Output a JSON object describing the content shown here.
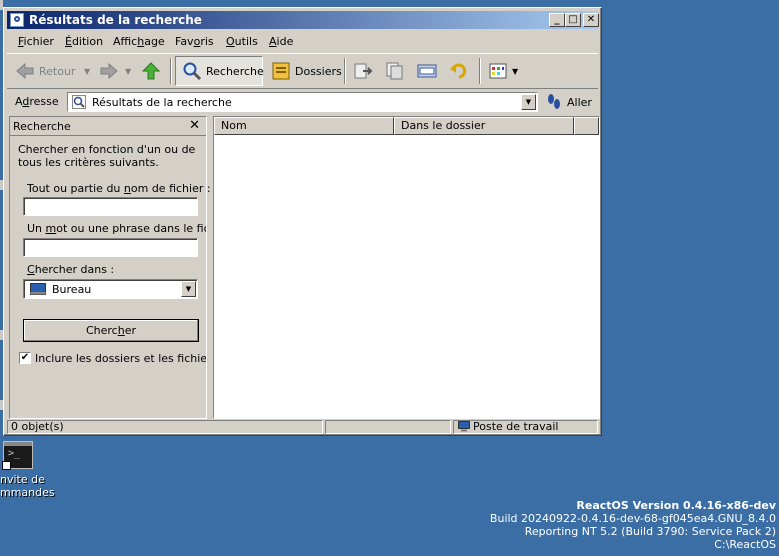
{
  "window": {
    "title": "Résultats de la recherche"
  },
  "menu": {
    "items": [
      {
        "pre": "",
        "key": "F",
        "post": "ichier"
      },
      {
        "pre": "",
        "key": "É",
        "post": "dition"
      },
      {
        "pre": "Affic",
        "key": "h",
        "post": "age"
      },
      {
        "pre": "Fav",
        "key": "o",
        "post": "ris"
      },
      {
        "pre": "",
        "key": "O",
        "post": "utils"
      },
      {
        "pre": "",
        "key": "A",
        "post": "ide"
      }
    ]
  },
  "toolbar": {
    "back_label": "Retour",
    "search_label": "Recherche",
    "folders_label": "Dossiers"
  },
  "address": {
    "label_key": "d",
    "label_pre": "A",
    "label_post": "resse",
    "value": "Résultats de la recherche",
    "go_label": "Aller"
  },
  "search_panel": {
    "title": "Recherche",
    "description": "Chercher en fonction d'un ou de tous les critères suivants.",
    "filename_pre": "Tout ou partie du ",
    "filename_key": "n",
    "filename_post": "om de fichier :",
    "phrase_pre": "Un ",
    "phrase_key": "m",
    "phrase_post": "ot ou une phrase dans le fichier :",
    "lookin_pre": "",
    "lookin_key": "C",
    "lookin_post": "hercher dans :",
    "lookin_value": "Bureau",
    "search_pre": "Cherc",
    "search_key": "h",
    "search_post": "er",
    "include_label": "Inclure les dossiers et les fichiers cachés",
    "include_checked": true
  },
  "results": {
    "columns": [
      "Nom",
      "Dans le dossier"
    ]
  },
  "status": {
    "count": "0 objet(s)",
    "zone": "Poste de travail"
  },
  "desktop": {
    "cmd_label_line1": "nvite de",
    "cmd_label_line2": "mmandes"
  },
  "version": {
    "line1": "ReactOS Version 0.4.16-x86-dev",
    "line2": "Build 20240922-0.4.16-dev-68-gf045ea4.GNU_8.4.0",
    "line3": "Reporting NT 5.2 (Build 3790: Service Pack 2)",
    "line4": "C:\\ReactOS"
  }
}
